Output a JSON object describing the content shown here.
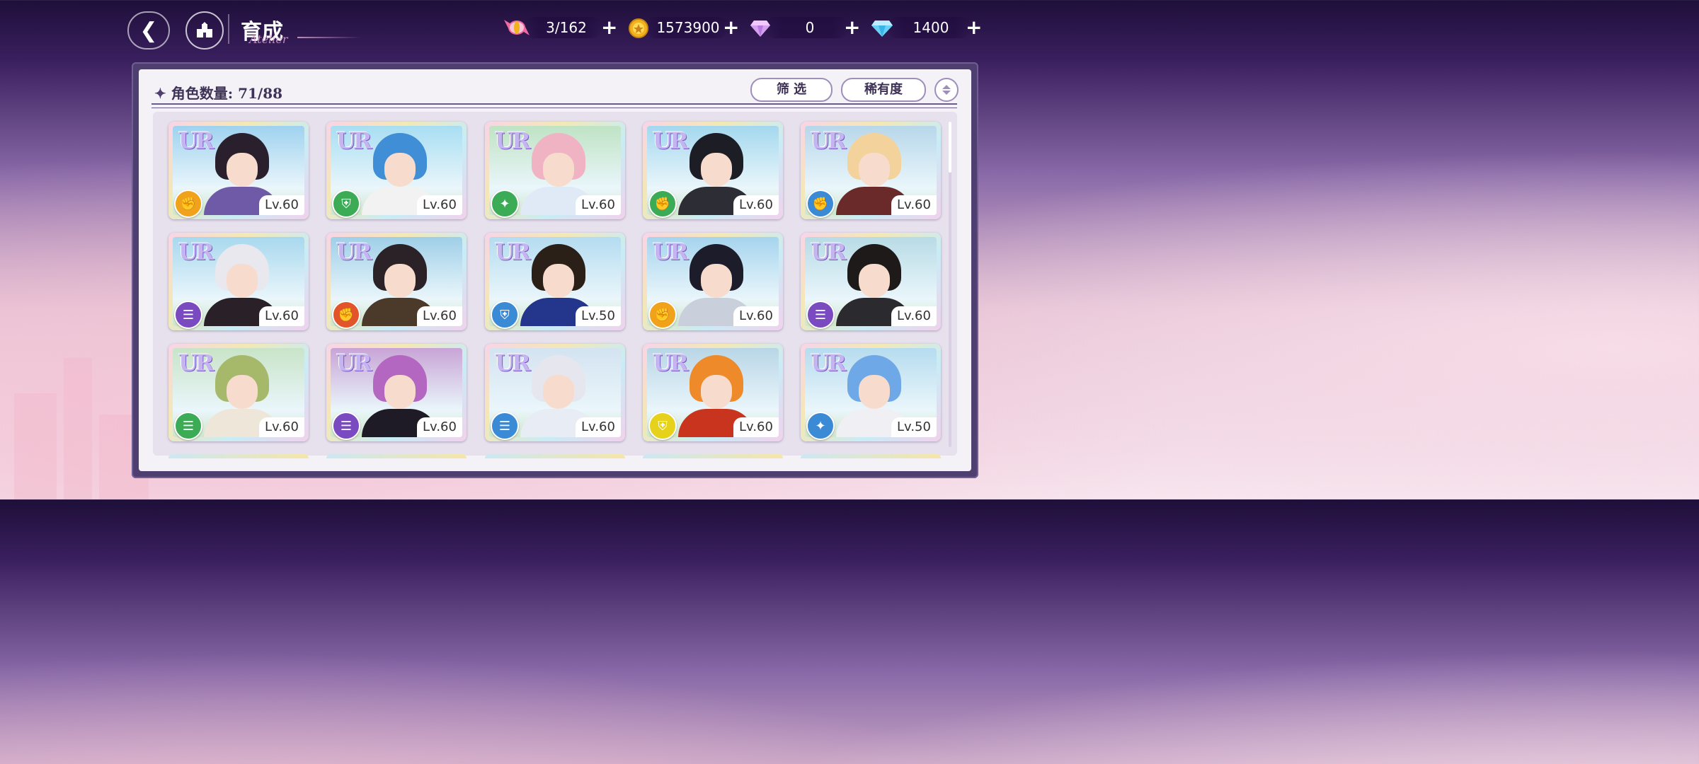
{
  "header": {
    "title": "育成",
    "title_script": "Atelier",
    "currencies": [
      {
        "name": "candy",
        "value": "3/162",
        "color": "#f06aa0"
      },
      {
        "name": "coin",
        "value": "1573900",
        "color": "#f2b21c"
      },
      {
        "name": "purple-gem",
        "value": "0",
        "color": "#c98ae8"
      },
      {
        "name": "blue-diamond",
        "value": "1400",
        "color": "#6ad0f5"
      }
    ],
    "plus_label": "+"
  },
  "panel": {
    "count_label": "角色数量: 71/88",
    "filter_label": "筛 选",
    "rarity_label": "稀有度"
  },
  "characters": [
    {
      "rarity": "UR",
      "attr": "fist",
      "attr_color": "#f0a21a",
      "level": "Lv.60",
      "hair": "#2a1f2c",
      "outfit": "#6e5aa6",
      "bg": "#9fd2ef"
    },
    {
      "rarity": "UR",
      "attr": "shield",
      "attr_color": "#3bab56",
      "level": "Lv.60",
      "hair": "#3f8ed6",
      "outfit": "#f2f2f2",
      "bg": "#a8def2"
    },
    {
      "rarity": "UR",
      "attr": "wand",
      "attr_color": "#3bab56",
      "level": "Lv.60",
      "hair": "#f0b3c3",
      "outfit": "#dfeaf6",
      "bg": "#bfe3c4"
    },
    {
      "rarity": "UR",
      "attr": "fist",
      "attr_color": "#3bab56",
      "level": "Lv.60",
      "hair": "#1d1d26",
      "outfit": "#2d2d35",
      "bg": "#a4d8ee"
    },
    {
      "rarity": "UR",
      "attr": "fist",
      "attr_color": "#3b8ad6",
      "level": "Lv.60",
      "hair": "#f3d29c",
      "outfit": "#6b2a2a",
      "bg": "#b7d7ea"
    },
    {
      "rarity": "UR",
      "attr": "book",
      "attr_color": "#7a4bc0",
      "level": "Lv.60",
      "hair": "#e8e8ee",
      "outfit": "#2a2028",
      "bg": "#a8d8ee"
    },
    {
      "rarity": "UR",
      "attr": "fist",
      "attr_color": "#e2552a",
      "level": "Lv.60",
      "hair": "#2a2226",
      "outfit": "#4b3a2a",
      "bg": "#9fcfe8"
    },
    {
      "rarity": "UR",
      "attr": "shield",
      "attr_color": "#3b8ad6",
      "level": "Lv.50",
      "hair": "#2a2018",
      "outfit": "#23368c",
      "bg": "#b4dcf0"
    },
    {
      "rarity": "UR",
      "attr": "fist",
      "attr_color": "#f0a21a",
      "level": "Lv.60",
      "hair": "#1c1c2a",
      "outfit": "#c9d0dc",
      "bg": "#a6d4ee"
    },
    {
      "rarity": "UR",
      "attr": "book",
      "attr_color": "#7a4bc0",
      "level": "Lv.60",
      "hair": "#1e1a1a",
      "outfit": "#2b2b2f",
      "bg": "#b8dbe6"
    },
    {
      "rarity": "UR",
      "attr": "book",
      "attr_color": "#3bab56",
      "level": "Lv.60",
      "hair": "#a6b86a",
      "outfit": "#efe6da",
      "bg": "#c9e4c8"
    },
    {
      "rarity": "UR",
      "attr": "book",
      "attr_color": "#7a4bc0",
      "level": "Lv.60",
      "hair": "#b467c0",
      "outfit": "#1e1a26",
      "bg": "#c8a4d6"
    },
    {
      "rarity": "UR",
      "attr": "book",
      "attr_color": "#3b8ad6",
      "level": "Lv.60",
      "hair": "#e6e6ef",
      "outfit": "#e8ecf4",
      "bg": "#d3e3f0"
    },
    {
      "rarity": "UR",
      "attr": "shield",
      "attr_color": "#e6d21a",
      "level": "Lv.60",
      "hair": "#ee8a2a",
      "outfit": "#c8341e",
      "bg": "#b9d6e6"
    },
    {
      "rarity": "UR",
      "attr": "wand",
      "attr_color": "#3b8ad6",
      "level": "Lv.50",
      "hair": "#6fa8e6",
      "outfit": "#efeff4",
      "bg": "#b6dcef"
    }
  ]
}
